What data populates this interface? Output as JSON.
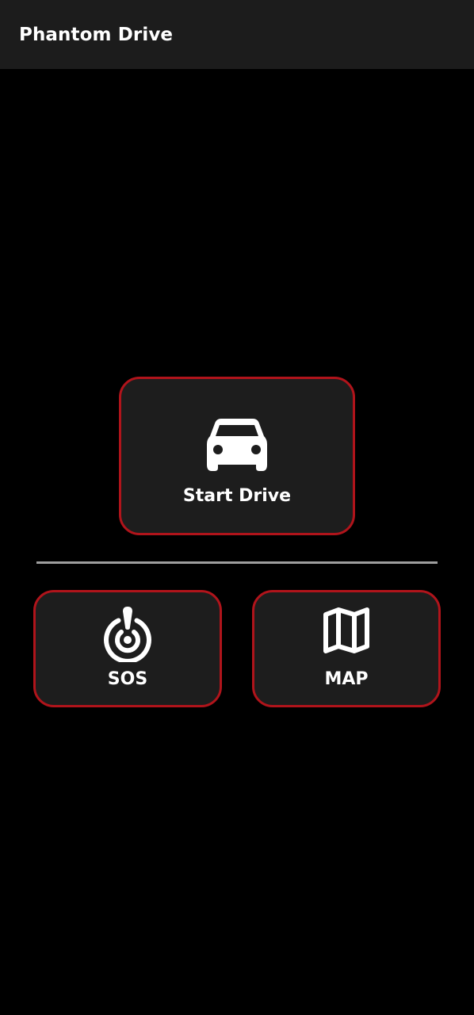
{
  "app_bar": {
    "title": "Phantom Drive",
    "background": "#1c1c1c"
  },
  "theme": {
    "background": "#000000",
    "tile_background": "#1d1d1d",
    "tile_border": "#b0141b",
    "divider": "#9e9e9e",
    "text": "#ffffff"
  },
  "main": {
    "start_drive": {
      "label": "Start Drive",
      "icon": "car-icon"
    },
    "actions": [
      {
        "label": "SOS",
        "icon": "sos-beacon-icon"
      },
      {
        "label": "MAP",
        "icon": "map-icon"
      }
    ]
  }
}
